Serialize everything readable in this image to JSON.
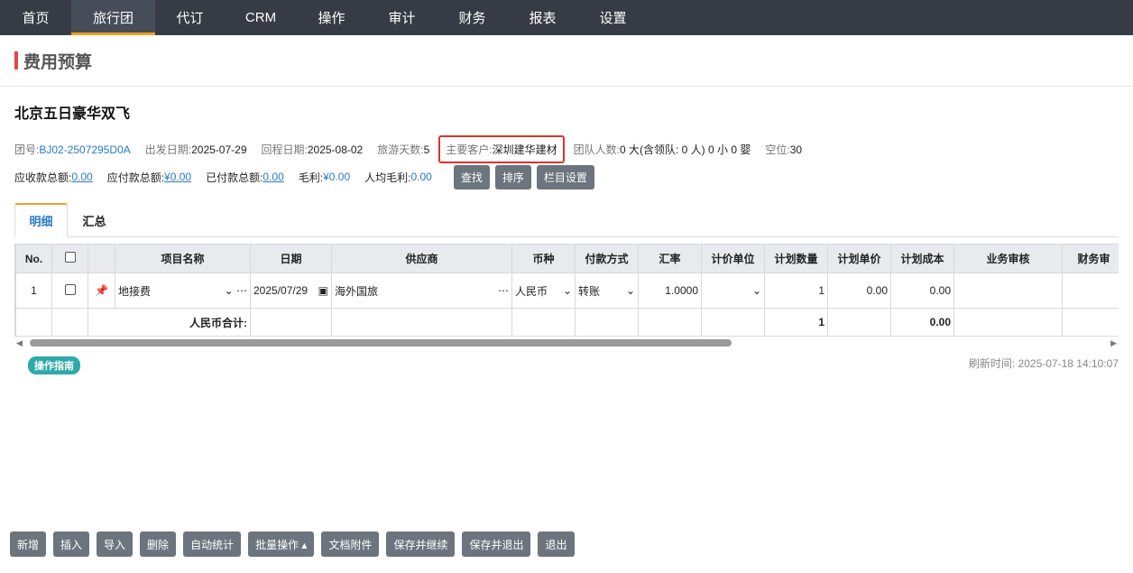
{
  "nav": [
    {
      "label": "首页",
      "w": 79,
      "active": false
    },
    {
      "label": "旅行团",
      "w": 93,
      "active": true
    },
    {
      "label": "代订",
      "w": 77,
      "active": false
    },
    {
      "label": "CRM",
      "w": 80,
      "active": false
    },
    {
      "label": "操作",
      "w": 77,
      "active": false
    },
    {
      "label": "审计",
      "w": 79,
      "active": false
    },
    {
      "label": "财务",
      "w": 77,
      "active": false
    },
    {
      "label": "报表",
      "w": 79,
      "active": false
    },
    {
      "label": "设置",
      "w": 77,
      "active": false
    }
  ],
  "page_title": "费用预算",
  "group_name": "北京五日豪华双飞",
  "info": {
    "group_no_label": "团号:",
    "group_no": "BJ02-2507295D0A",
    "depart_label": "出发日期:",
    "depart": "2025-07-29",
    "return_label": "回程日期:",
    "return": "2025-08-02",
    "days_label": "旅游天数:",
    "days": "5",
    "customer_label": "主要客户:",
    "customer": "深圳建华建材",
    "team_label": "团队人数:",
    "team": "0 大(含领队: 0 人) 0 小 0 婴",
    "vacancy_label": "空位:",
    "vacancy": "30"
  },
  "summary": {
    "receivable_label": "应收款总额:",
    "receivable": "0.00",
    "payable_label": "应付款总额:",
    "payable": "¥0.00",
    "paid_label": "已付款总额:",
    "paid": "0.00",
    "profit_label": "毛利:",
    "profit": "¥0.00",
    "per_profit_label": "人均毛利:",
    "per_profit": "0.00",
    "find_btn": "查找",
    "sort_btn": "排序",
    "columns_btn": "栏目设置"
  },
  "tabs": {
    "detail": "明细",
    "total": "汇总"
  },
  "table": {
    "headers": {
      "no": "No.",
      "item": "项目名称",
      "date": "日期",
      "supplier": "供应商",
      "currency": "币种",
      "pay": "付款方式",
      "rate": "汇率",
      "unit": "计价单位",
      "qty": "计划数量",
      "price": "计划单价",
      "cost": "计划成本",
      "biz": "业务审核",
      "fin": "财务审"
    },
    "row": {
      "no": "1",
      "item": "地接费",
      "date": "2025/07/29",
      "supplier": "海外国旅",
      "currency": "人民币",
      "pay": "转账",
      "rate": "1.0000",
      "unit": "",
      "qty": "1",
      "price": "0.00",
      "cost": "0.00"
    },
    "total": {
      "label": "人民币合计:",
      "qty": "1",
      "cost": "0.00"
    }
  },
  "guide_badge": "操作指南",
  "refresh": "刷新时间: 2025-07-18 14:10:07",
  "bottom": {
    "add": "新增",
    "insert": "插入",
    "import": "导入",
    "delete": "删除",
    "auto": "自动统计",
    "batch": "批量操作 ▴",
    "docs": "文档附件",
    "save_cont": "保存并继续",
    "save_exit": "保存并退出",
    "exit": "退出"
  }
}
